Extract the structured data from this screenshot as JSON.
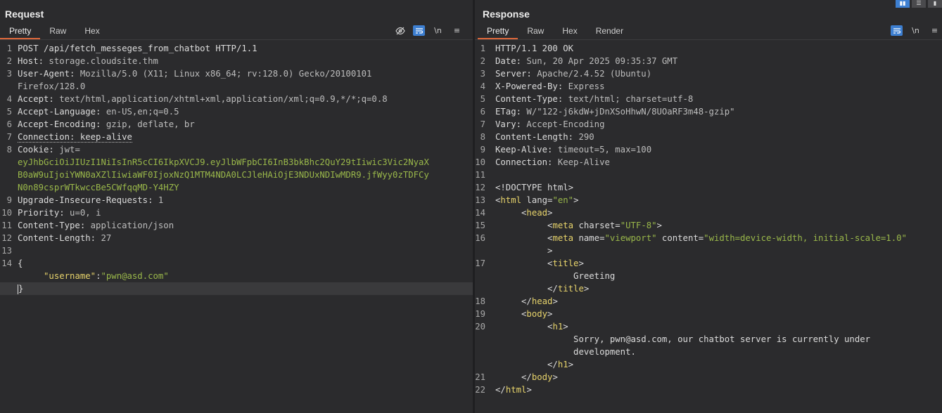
{
  "request": {
    "title": "Request",
    "tabs": [
      "Pretty",
      "Raw",
      "Hex"
    ],
    "toolbar_icons": [
      "eye-off-icon",
      "wrap-icon",
      "newline-icon",
      "menu-icon"
    ],
    "newline_label": "\\n",
    "lines": [
      {
        "n": "1",
        "segs": [
          {
            "t": "POST /api/fetch_messeges_from_chatbot HTTP/1.1",
            "c": "key"
          }
        ]
      },
      {
        "n": "2",
        "segs": [
          {
            "t": "Host: ",
            "c": "key"
          },
          {
            "t": "storage.cloudsite.thm",
            "c": "val"
          }
        ]
      },
      {
        "n": "3",
        "segs": [
          {
            "t": "User-Agent: ",
            "c": "key"
          },
          {
            "t": "Mozilla/5.0 (X11; Linux x86_64; rv:128.0) Gecko/20100101",
            "c": "val"
          }
        ]
      },
      {
        "n": "",
        "segs": [
          {
            "t": "Firefox/128.0",
            "c": "val"
          }
        ]
      },
      {
        "n": "4",
        "segs": [
          {
            "t": "Accept: ",
            "c": "key"
          },
          {
            "t": "text/html,application/xhtml+xml,application/xml;q=0.9,*/*;q=0.8",
            "c": "val"
          }
        ]
      },
      {
        "n": "5",
        "segs": [
          {
            "t": "Accept-Language: ",
            "c": "key"
          },
          {
            "t": "en-US,en;q=0.5",
            "c": "val"
          }
        ]
      },
      {
        "n": "6",
        "segs": [
          {
            "t": "Accept-Encoding: ",
            "c": "key"
          },
          {
            "t": "gzip, deflate, br",
            "c": "val"
          }
        ]
      },
      {
        "n": "7",
        "segs": [
          {
            "t": "Connection: keep-alive",
            "c": "key dotted"
          }
        ]
      },
      {
        "n": "8",
        "segs": [
          {
            "t": "Cookie: ",
            "c": "key"
          },
          {
            "t": "jwt=",
            "c": "val"
          }
        ]
      },
      {
        "n": "",
        "segs": [
          {
            "t": "eyJhbGciOiJIUzI1NiIsInR5cCI6IkpXVCJ9.eyJlbWFpbCI6InB3bkBhc2QuY29tIiwic3Vic2NyaX",
            "c": "jwt"
          }
        ]
      },
      {
        "n": "",
        "segs": [
          {
            "t": "B0aW9uIjoiYWN0aXZlIiwiaWF0IjoxNzQ1MTM4NDA0LCJleHAiOjE3NDUxNDIwMDR9.jfWyy0zTDFCy",
            "c": "jwt"
          }
        ]
      },
      {
        "n": "",
        "segs": [
          {
            "t": "N0n89csprWTkwccBe5CWfqqMD-Y4HZY",
            "c": "jwt"
          }
        ]
      },
      {
        "n": "9",
        "segs": [
          {
            "t": "Upgrade-Insecure-Requests: ",
            "c": "key"
          },
          {
            "t": "1",
            "c": "val"
          }
        ]
      },
      {
        "n": "10",
        "segs": [
          {
            "t": "Priority: ",
            "c": "key"
          },
          {
            "t": "u=0, i",
            "c": "val"
          }
        ]
      },
      {
        "n": "11",
        "segs": [
          {
            "t": "Content-Type: ",
            "c": "key"
          },
          {
            "t": "application/json",
            "c": "val"
          }
        ]
      },
      {
        "n": "12",
        "segs": [
          {
            "t": "Content-Length: ",
            "c": "key"
          },
          {
            "t": "27",
            "c": "val"
          }
        ]
      },
      {
        "n": "13",
        "segs": []
      },
      {
        "n": "14",
        "segs": [
          {
            "t": "{",
            "c": "key"
          }
        ]
      },
      {
        "n": "",
        "segs": [
          {
            "t": "     ",
            "c": "key"
          },
          {
            "t": "\"username\"",
            "c": "jkey"
          },
          {
            "t": ":",
            "c": "key"
          },
          {
            "t": "\"pwn@asd.com\"",
            "c": "str"
          }
        ]
      },
      {
        "n": "",
        "segs": [
          {
            "t": "}",
            "c": "key"
          }
        ],
        "cursor": true
      }
    ]
  },
  "response": {
    "title": "Response",
    "tabs": [
      "Pretty",
      "Raw",
      "Hex",
      "Render"
    ],
    "toolbar_icons": [
      "wrap-icon",
      "newline-icon",
      "menu-icon"
    ],
    "newline_label": "\\n",
    "lines": [
      {
        "n": "1",
        "segs": [
          {
            "t": "HTTP/1.1 200 OK",
            "c": "key"
          }
        ],
        "cursor": true
      },
      {
        "n": "2",
        "segs": [
          {
            "t": "Date: ",
            "c": "key"
          },
          {
            "t": "Sun, 20 Apr 2025 09:35:37 GMT",
            "c": "val"
          }
        ]
      },
      {
        "n": "3",
        "segs": [
          {
            "t": "Server: ",
            "c": "key"
          },
          {
            "t": "Apache/2.4.52 (Ubuntu)",
            "c": "val"
          }
        ]
      },
      {
        "n": "4",
        "segs": [
          {
            "t": "X-Powered-By: ",
            "c": "key"
          },
          {
            "t": "Express",
            "c": "val"
          }
        ]
      },
      {
        "n": "5",
        "segs": [
          {
            "t": "Content-Type: ",
            "c": "key"
          },
          {
            "t": "text/html; charset=utf-8",
            "c": "val"
          }
        ]
      },
      {
        "n": "6",
        "segs": [
          {
            "t": "ETag: ",
            "c": "key"
          },
          {
            "t": "W/\"122-j6kdW+jDnXSoHhwN/8UOaRF3m48-gzip\"",
            "c": "val"
          }
        ]
      },
      {
        "n": "7",
        "segs": [
          {
            "t": "Vary: ",
            "c": "key"
          },
          {
            "t": "Accept-Encoding",
            "c": "val"
          }
        ]
      },
      {
        "n": "8",
        "segs": [
          {
            "t": "Content-Length: ",
            "c": "key"
          },
          {
            "t": "290",
            "c": "val"
          }
        ]
      },
      {
        "n": "9",
        "segs": [
          {
            "t": "Keep-Alive: ",
            "c": "key"
          },
          {
            "t": "timeout=5, max=100",
            "c": "val"
          }
        ]
      },
      {
        "n": "10",
        "segs": [
          {
            "t": "Connection: ",
            "c": "key"
          },
          {
            "t": "Keep-Alive",
            "c": "val"
          }
        ]
      },
      {
        "n": "11",
        "segs": []
      },
      {
        "n": "12",
        "segs": [
          {
            "t": "<!DOCTYPE html>",
            "c": "key"
          }
        ]
      },
      {
        "n": "13",
        "segs": [
          {
            "t": "<",
            "c": "key"
          },
          {
            "t": "html",
            "c": "tag"
          },
          {
            "t": " lang=",
            "c": "attr"
          },
          {
            "t": "\"en\"",
            "c": "str"
          },
          {
            "t": ">",
            "c": "key"
          }
        ]
      },
      {
        "n": "14",
        "segs": [
          {
            "t": "     <",
            "c": "key"
          },
          {
            "t": "head",
            "c": "tag"
          },
          {
            "t": ">",
            "c": "key"
          }
        ]
      },
      {
        "n": "15",
        "segs": [
          {
            "t": "          <",
            "c": "key"
          },
          {
            "t": "meta",
            "c": "tag"
          },
          {
            "t": " charset=",
            "c": "attr"
          },
          {
            "t": "\"UTF-8\"",
            "c": "str"
          },
          {
            "t": ">",
            "c": "key"
          }
        ]
      },
      {
        "n": "16",
        "segs": [
          {
            "t": "          <",
            "c": "key"
          },
          {
            "t": "meta",
            "c": "tag"
          },
          {
            "t": " name=",
            "c": "attr"
          },
          {
            "t": "\"viewport\"",
            "c": "str"
          },
          {
            "t": " content=",
            "c": "attr"
          },
          {
            "t": "\"width=device-width, initial-scale=1.0\"",
            "c": "str"
          }
        ]
      },
      {
        "n": "",
        "segs": [
          {
            "t": "          >",
            "c": "key"
          }
        ]
      },
      {
        "n": "17",
        "segs": [
          {
            "t": "          <",
            "c": "key"
          },
          {
            "t": "title",
            "c": "tag"
          },
          {
            "t": ">",
            "c": "key"
          }
        ]
      },
      {
        "n": "",
        "segs": [
          {
            "t": "               Greeting",
            "c": "key"
          }
        ]
      },
      {
        "n": "",
        "segs": [
          {
            "t": "          </",
            "c": "key"
          },
          {
            "t": "title",
            "c": "tag"
          },
          {
            "t": ">",
            "c": "key"
          }
        ]
      },
      {
        "n": "18",
        "segs": [
          {
            "t": "     </",
            "c": "key"
          },
          {
            "t": "head",
            "c": "tag"
          },
          {
            "t": ">",
            "c": "key"
          }
        ]
      },
      {
        "n": "19",
        "segs": [
          {
            "t": "     <",
            "c": "key"
          },
          {
            "t": "body",
            "c": "tag"
          },
          {
            "t": ">",
            "c": "key"
          }
        ]
      },
      {
        "n": "20",
        "segs": [
          {
            "t": "          <",
            "c": "key"
          },
          {
            "t": "h1",
            "c": "tag"
          },
          {
            "t": ">",
            "c": "key"
          }
        ]
      },
      {
        "n": "",
        "segs": [
          {
            "t": "               Sorry, pwn@asd.com, our chatbot server is currently under",
            "c": "key"
          }
        ]
      },
      {
        "n": "",
        "segs": [
          {
            "t": "               development.",
            "c": "key"
          }
        ]
      },
      {
        "n": "",
        "segs": [
          {
            "t": "          </",
            "c": "key"
          },
          {
            "t": "h1",
            "c": "tag"
          },
          {
            "t": ">",
            "c": "key"
          }
        ]
      },
      {
        "n": "21",
        "segs": [
          {
            "t": "     </",
            "c": "key"
          },
          {
            "t": "body",
            "c": "tag"
          },
          {
            "t": ">",
            "c": "key"
          }
        ]
      },
      {
        "n": "22",
        "segs": [
          {
            "t": "</",
            "c": "key"
          },
          {
            "t": "html",
            "c": "tag"
          },
          {
            "t": ">",
            "c": "key"
          }
        ]
      }
    ]
  },
  "layout_buttons": [
    "split-horizontal-icon",
    "split-vertical-icon",
    "single-pane-icon"
  ]
}
